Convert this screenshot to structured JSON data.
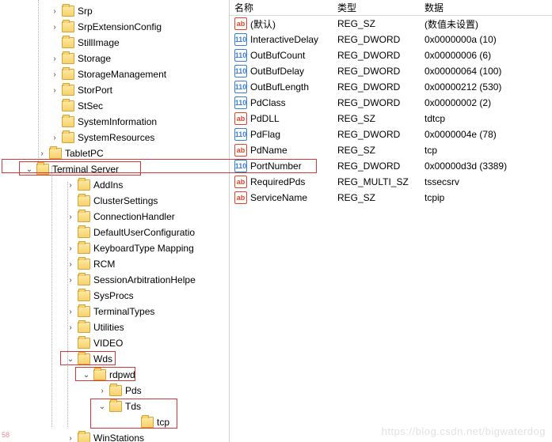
{
  "tree": {
    "items": [
      {
        "label": "Srp",
        "indentClass": "ind-0",
        "twisty": "closed"
      },
      {
        "label": "SrpExtensionConfig",
        "indentClass": "ind-0",
        "twisty": "closed"
      },
      {
        "label": "StillImage",
        "indentClass": "ind-0",
        "twisty": "none"
      },
      {
        "label": "Storage",
        "indentClass": "ind-0",
        "twisty": "closed"
      },
      {
        "label": "StorageManagement",
        "indentClass": "ind-0",
        "twisty": "closed"
      },
      {
        "label": "StorPort",
        "indentClass": "ind-0",
        "twisty": "closed"
      },
      {
        "label": "StSec",
        "indentClass": "ind-0",
        "twisty": "none"
      },
      {
        "label": "SystemInformation",
        "indentClass": "ind-0",
        "twisty": "none"
      },
      {
        "label": "SystemResources",
        "indentClass": "ind-0",
        "twisty": "closed"
      },
      {
        "label": "TabletPC",
        "indentClass": "ind-1",
        "twisty": "closed"
      },
      {
        "label": "Terminal Server",
        "indentClass": "ind-sp",
        "twisty": "open"
      },
      {
        "label": "AddIns",
        "indentClass": "ind-2",
        "twisty": "closed"
      },
      {
        "label": "ClusterSettings",
        "indentClass": "ind-2",
        "twisty": "none"
      },
      {
        "label": "ConnectionHandler",
        "indentClass": "ind-2",
        "twisty": "closed"
      },
      {
        "label": "DefaultUserConfiguratio",
        "indentClass": "ind-2",
        "twisty": "none"
      },
      {
        "label": "KeyboardType Mapping",
        "indentClass": "ind-2",
        "twisty": "closed"
      },
      {
        "label": "RCM",
        "indentClass": "ind-2",
        "twisty": "closed"
      },
      {
        "label": "SessionArbitrationHelpe",
        "indentClass": "ind-2",
        "twisty": "closed"
      },
      {
        "label": "SysProcs",
        "indentClass": "ind-2",
        "twisty": "none"
      },
      {
        "label": "TerminalTypes",
        "indentClass": "ind-2",
        "twisty": "closed"
      },
      {
        "label": "Utilities",
        "indentClass": "ind-2",
        "twisty": "closed"
      },
      {
        "label": "VIDEO",
        "indentClass": "ind-2",
        "twisty": "none"
      },
      {
        "label": "Wds",
        "indentClass": "ind-2",
        "twisty": "open"
      },
      {
        "label": "rdpwd",
        "indentClass": "ind-3",
        "twisty": "open"
      },
      {
        "label": "Pds",
        "indentClass": "ind-4",
        "twisty": "closed"
      },
      {
        "label": "Tds",
        "indentClass": "ind-4",
        "twisty": "open"
      },
      {
        "label": "tcp",
        "indentClass": "ind-6",
        "twisty": "none"
      },
      {
        "label": "WinStations",
        "indentClass": "ind-2",
        "twisty": "closed"
      }
    ]
  },
  "grid": {
    "headers": {
      "name": "名称",
      "type": "类型",
      "data": "数据"
    },
    "rows": [
      {
        "icon": "sz",
        "name": "(默认)",
        "type": "REG_SZ",
        "data": "(数值未设置)"
      },
      {
        "icon": "dw",
        "name": "InteractiveDelay",
        "type": "REG_DWORD",
        "data": "0x0000000a (10)"
      },
      {
        "icon": "dw",
        "name": "OutBufCount",
        "type": "REG_DWORD",
        "data": "0x00000006 (6)"
      },
      {
        "icon": "dw",
        "name": "OutBufDelay",
        "type": "REG_DWORD",
        "data": "0x00000064 (100)"
      },
      {
        "icon": "dw",
        "name": "OutBufLength",
        "type": "REG_DWORD",
        "data": "0x00000212 (530)"
      },
      {
        "icon": "dw",
        "name": "PdClass",
        "type": "REG_DWORD",
        "data": "0x00000002 (2)"
      },
      {
        "icon": "sz",
        "name": "PdDLL",
        "type": "REG_SZ",
        "data": "tdtcp"
      },
      {
        "icon": "dw",
        "name": "PdFlag",
        "type": "REG_DWORD",
        "data": "0x0000004e (78)"
      },
      {
        "icon": "sz",
        "name": "PdName",
        "type": "REG_SZ",
        "data": "tcp"
      },
      {
        "icon": "dw",
        "name": "PortNumber",
        "type": "REG_DWORD",
        "data": "0x00000d3d (3389)"
      },
      {
        "icon": "sz",
        "name": "RequiredPds",
        "type": "REG_MULTI_SZ",
        "data": "tssecsrv"
      },
      {
        "icon": "sz",
        "name": "ServiceName",
        "type": "REG_SZ",
        "data": "tcpip"
      }
    ]
  },
  "icons": {
    "sz": "ab",
    "dw": "110"
  },
  "watermark": "https://blog.csdn.net/bigwaterdog",
  "badge": "58"
}
